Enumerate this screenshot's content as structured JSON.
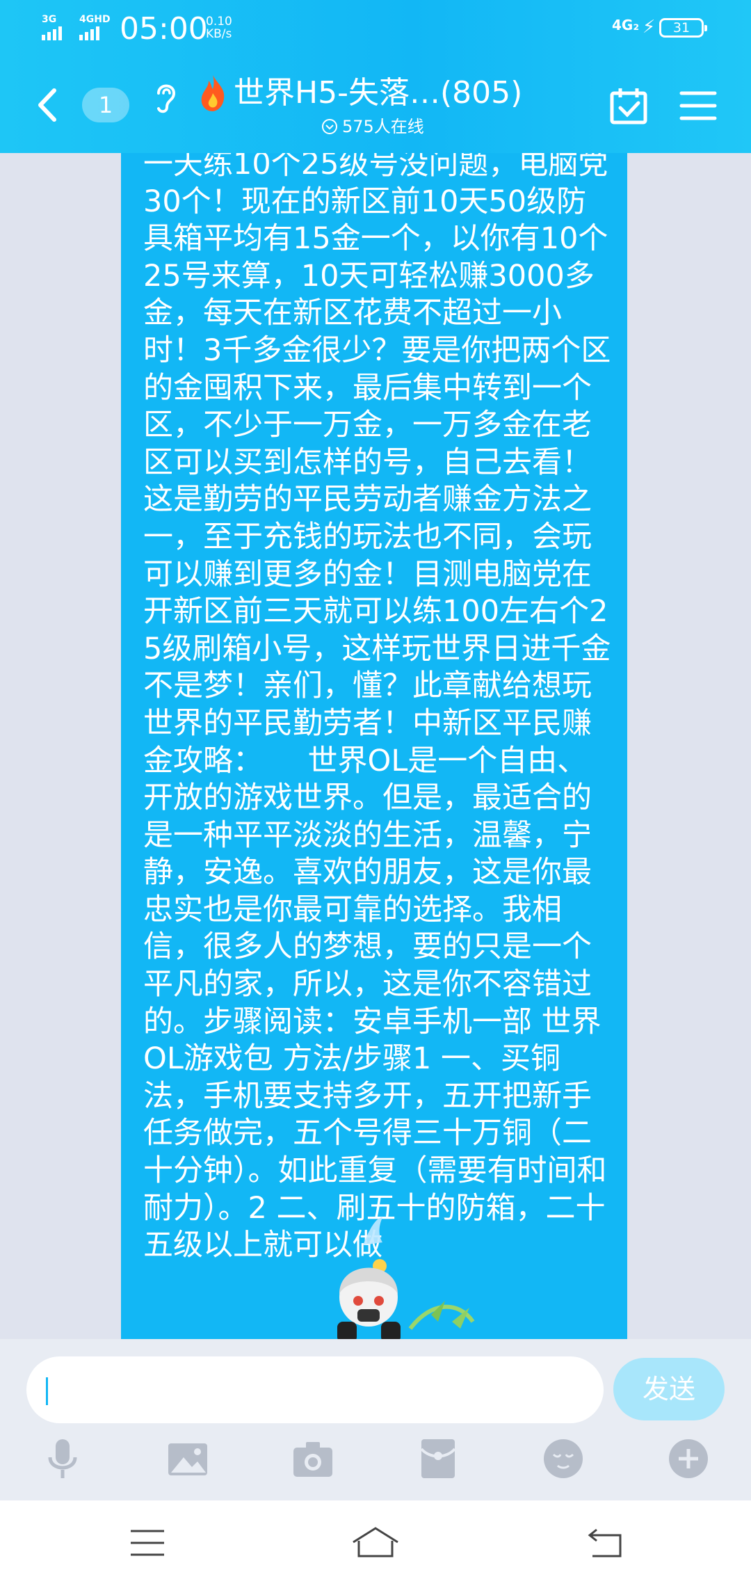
{
  "status_bar": {
    "network1": "3G",
    "network2": "4GHD",
    "time": "05:00",
    "speed_value": "0.10",
    "speed_unit": "KB/s",
    "network_right": "4G₂",
    "battery": "31"
  },
  "header": {
    "unread_count": "1",
    "title": "世界H5-失落…(805)",
    "online_text": "575人在线",
    "icons": [
      "back-icon",
      "ear-icon",
      "fire-icon",
      "calendar-check-icon",
      "menu-icon"
    ]
  },
  "message": {
    "text": "一天练10个25级号没问题，电脑党30个！现在的新区前10天50级防具箱平均有15金一个，以你有10个25号来算，10天可轻松赚3000多金，每天在新区花费不超过一小时！3千多金很少？要是你把两个区的金囤积下来，最后集中转到一个区，不少于一万金，一万多金在老区可以买到怎样的号，自己去看！这是勤劳的平民劳动者赚金方法之一，至于充钱的玩法也不同，会玩可以赚到更多的金！目测电脑党在开新区前三天就可以练100左右个25级刷箱小号，这样玩世界日进千金不是梦！亲们，懂？此章献给想玩世界的平民勤劳者！中新区平民赚金攻略：　　世界OL是一个自由、开放的游戏世界。但是，最适合的是一种平平淡淡的生活，温馨，宁静，安逸。喜欢的朋友，这是你最忠实也是你最可靠的选择。我相信，很多人的梦想，要的只是一个平凡的家，所以，这是你不容错过的。步骤阅读：安卓手机一部 世界OL游戏包 方法/步骤1 一、买铜法，手机要支持多开，五开把新手任务做完，五个号得三十万铜（二十分钟）。如此重复（需要有时间和耐力）。2 二、刷五十的防箱，二十五级以上就可以做",
    "bubble_color": "#12b7f5"
  },
  "input_bar": {
    "placeholder": "",
    "send_label": "发送",
    "tools": [
      "microphone-icon",
      "image-icon",
      "camera-icon",
      "red-packet-icon",
      "emoji-icon",
      "plus-icon"
    ]
  },
  "nav_bar": {
    "icons": [
      "nav-menu-icon",
      "nav-home-icon",
      "nav-back-icon"
    ]
  },
  "colors": {
    "accent": "#12b7f5",
    "background": "#dfe3ee"
  }
}
